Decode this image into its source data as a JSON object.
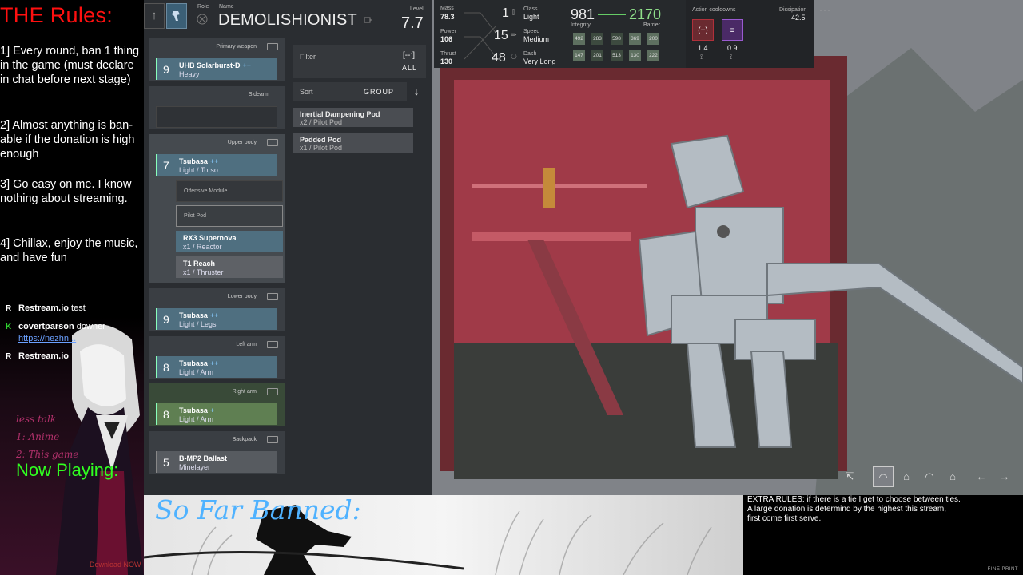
{
  "rules_panel": {
    "title": "THE Rules:",
    "rules": [
      "1]  Every round, ban 1 thing in the game (must declare in chat before next stage)",
      "2]  Almost anything is ban-able if the donation is high enough",
      "3]  Go easy on me. I know nothing about streaming.",
      "4] Chillax, enjoy the music, and have fun"
    ]
  },
  "chat": [
    {
      "icon": "R",
      "user": "Restream.io",
      "text": "test"
    },
    {
      "icon": "K",
      "user": "covertparson",
      "text": "downer"
    },
    {
      "icon": "—",
      "user": "",
      "text": "https://nezhn..."
    },
    {
      "icon": "R",
      "user": "Restream.io",
      "text": ""
    }
  ],
  "overlay_notes": [
    "less talk",
    "1: Anime",
    "2: This game"
  ],
  "now_playing": "Now Playing:",
  "download_now": "Download NOW",
  "nav": {
    "back_icon": "↑",
    "mech_icon": "mech-icon"
  },
  "role_label": "Role",
  "name_label": "Name",
  "mech_name": "DEMOLISHIONIST",
  "level": {
    "label": "Level",
    "value": "7.7"
  },
  "loadout": {
    "primary": {
      "label": "Primary weapon",
      "level": "9",
      "name": "UHB Solarburst-D",
      "plus": "++",
      "sub": "Heavy"
    },
    "sidearm": {
      "label": "Sidearm"
    },
    "upper": {
      "label": "Upper body",
      "level": "7",
      "name": "Tsubasa",
      "plus": "++",
      "sub": "Light / Torso",
      "offensive_module": "Offensive Module",
      "pilot_pod": "Pilot Pod",
      "reactor": {
        "name": "RX3 Supernova",
        "sub": "x1 / Reactor"
      },
      "thruster": {
        "name": "T1 Reach",
        "sub": "x1 / Thruster"
      }
    },
    "lower": {
      "label": "Lower body",
      "level": "9",
      "name": "Tsubasa",
      "plus": "++",
      "sub": "Light / Legs"
    },
    "left_arm": {
      "label": "Left arm",
      "level": "8",
      "name": "Tsubasa",
      "plus": "++",
      "sub": "Light / Arm"
    },
    "right_arm": {
      "label": "Right arm",
      "level": "8",
      "name": "Tsubasa",
      "plus": "+",
      "sub": "Light / Arm"
    },
    "backpack": {
      "label": "Backpack",
      "level": "5",
      "name": "B-MP2 Ballast",
      "sub": "Minelayer"
    }
  },
  "filter": {
    "label": "Filter",
    "icon": "[--:]",
    "value": "ALL"
  },
  "sort": {
    "label": "Sort",
    "value": "GROUP",
    "arrow": "↓"
  },
  "items": [
    {
      "name": "Inertial Dampening Pod",
      "sub": "x2 / Pilot Pod"
    },
    {
      "name": "Padded Pod",
      "sub": "x1 / Pilot Pod"
    }
  ],
  "stats": {
    "mass": {
      "label": "Mass",
      "value": "78.3"
    },
    "power": {
      "label": "Power",
      "value": "106"
    },
    "thrust": {
      "label": "Thrust",
      "value": "130"
    },
    "class": {
      "label": "Class",
      "num": "1",
      "value": "Light"
    },
    "speed": {
      "label": "Speed",
      "num": "15",
      "value": "Medium"
    },
    "dash": {
      "label": "Dash",
      "num": "48",
      "value": "Very Long"
    },
    "integrity": {
      "label": "Integrity",
      "value": "981"
    },
    "barrier": {
      "label": "Barrier",
      "value": "2170"
    },
    "integrity_cells": [
      "492",
      "283",
      "598",
      "369",
      "200",
      "147",
      "201",
      "513",
      "130",
      "222"
    ],
    "cooldowns_label": "Action cooldowns",
    "cooldowns": [
      {
        "icon": "(+)",
        "value": "1.4",
        "color": "#b0303a"
      },
      {
        "icon": "≡",
        "value": "0.9",
        "color": "#7a3aa0"
      }
    ],
    "dissipation": {
      "label": "Dissipation",
      "value": "42.5"
    },
    "more": "···"
  },
  "camera": [
    "⇱",
    "◠",
    "⌂",
    "◠",
    "⌂",
    "←",
    "→"
  ],
  "banned_title": "So Far Banned:",
  "extra_rules": [
    "EXTRA RULES:   if there is a tie I get to choose between ties.",
    "A large donation is determind by the highest this stream,",
    "first come first serve."
  ],
  "fine_print": "FINE PRINT",
  "colors": {
    "accent_red": "#ff1010",
    "now_playing": "#30ff20",
    "banned_title": "#4fb2ff",
    "barrier": "#8fdf8a"
  }
}
